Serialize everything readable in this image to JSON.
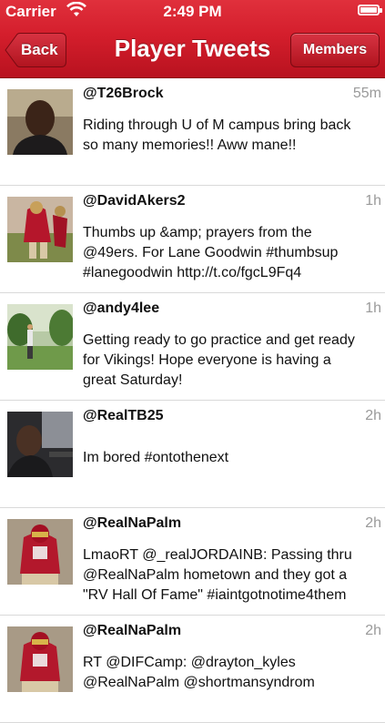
{
  "status_bar": {
    "carrier": "Carrier",
    "time": "2:49 PM"
  },
  "nav": {
    "back_label": "Back",
    "title": "Player Tweets",
    "members_label": "Members"
  },
  "tweets": [
    {
      "handle": "@T26Brock",
      "age": "55m",
      "text": "Riding through U of M campus bring back\nso many memories!! Aww mane!!"
    },
    {
      "handle": "@DavidAkers2",
      "age": "1h",
      "text": "Thumbs up &amp; prayers from the\n@49ers. For Lane Goodwin #thumbsup\n#lanegoodwin http://t.co/fgcL9Fq4"
    },
    {
      "handle": "@andy4lee",
      "age": "1h",
      "text": "Getting ready to go practice and get ready\nfor Vikings!  Hope everyone is having a\ngreat Saturday!"
    },
    {
      "handle": "@RealTB25",
      "age": "2h",
      "text": "Im bored #ontothenext"
    },
    {
      "handle": "@RealNaPalm",
      "age": "2h",
      "text": "LmaoRT @_realJORDAINB: Passing thru\n@RealNaPalm hometown and they got a\n\"RV Hall Of Fame\" #iaintgotnotime4them"
    },
    {
      "handle": "@RealNaPalm",
      "age": "2h",
      "text": "RT @DIFCamp: @drayton_kyles\n@RealNaPalm @shortmansyndrom"
    }
  ]
}
